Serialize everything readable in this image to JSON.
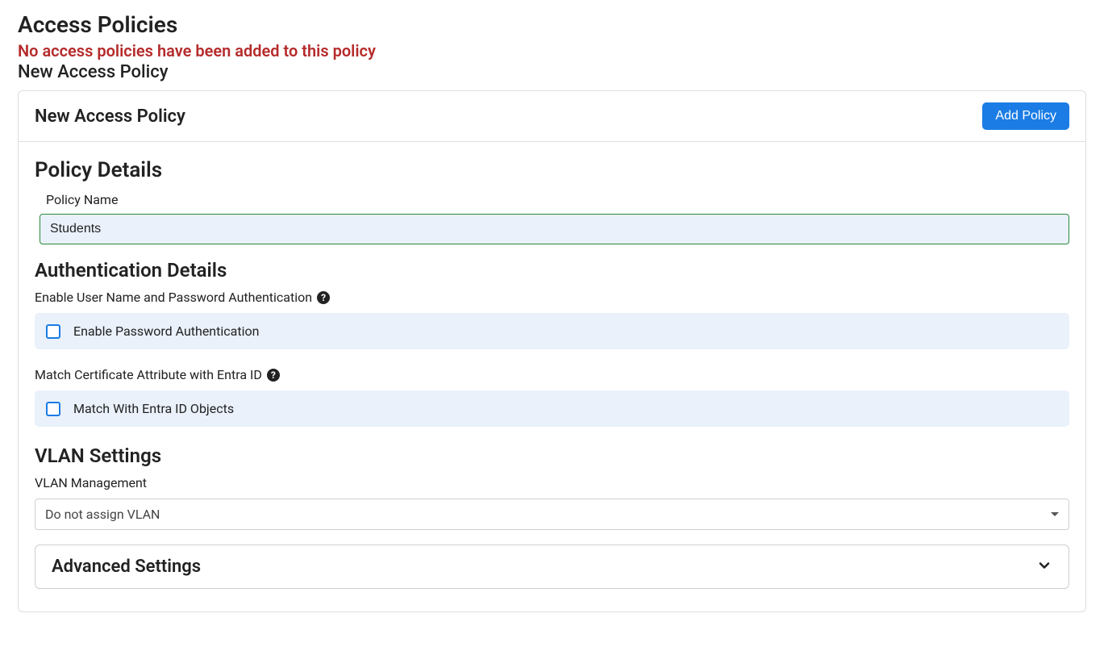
{
  "page": {
    "title": "Access Policies",
    "empty_message": "No access policies have been added to this policy",
    "subtitle": "New Access Policy"
  },
  "card": {
    "header_title": "New Access Policy",
    "add_button": "Add Policy"
  },
  "policy_details": {
    "section_title": "Policy Details",
    "name_label": "Policy Name",
    "name_value": "Students"
  },
  "auth": {
    "section_title": "Authentication Details",
    "enable_label": "Enable User Name and Password Authentication",
    "enable_checkbox_label": "Enable Password Authentication",
    "match_label": "Match Certificate Attribute with Entra ID",
    "match_checkbox_label": "Match With Entra ID Objects"
  },
  "vlan": {
    "section_title": "VLAN Settings",
    "mgmt_label": "VLAN Management",
    "mgmt_value": "Do not assign VLAN"
  },
  "advanced": {
    "title": "Advanced Settings"
  }
}
